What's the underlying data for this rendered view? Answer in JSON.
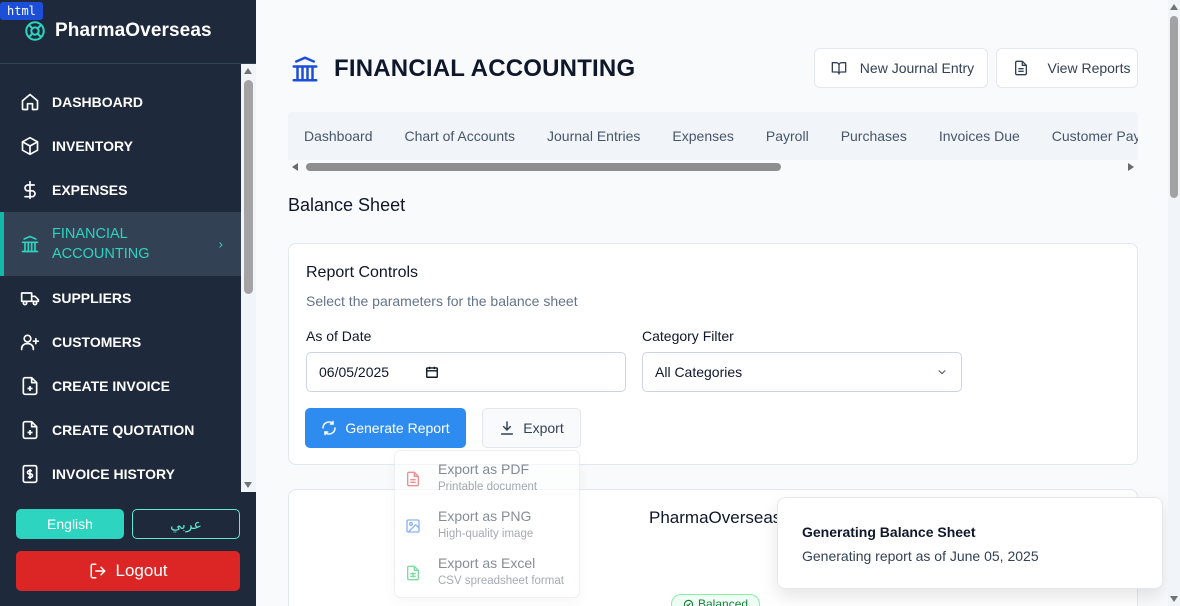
{
  "debug_tag": "html",
  "brand": {
    "name": "PharmaOverseas",
    "icon": "lifebuoy-icon"
  },
  "sidebar": {
    "items": [
      {
        "label": "DASHBOARD",
        "icon": "home-icon"
      },
      {
        "label": "INVENTORY",
        "icon": "box-icon"
      },
      {
        "label": "EXPENSES",
        "icon": "dollar-icon"
      },
      {
        "label": "FINANCIAL ACCOUNTING",
        "icon": "bank-icon",
        "active": true
      },
      {
        "label": "SUPPLIERS",
        "icon": "truck-icon"
      },
      {
        "label": "CUSTOMERS",
        "icon": "user-plus-icon"
      },
      {
        "label": "CREATE INVOICE",
        "icon": "file-plus-icon"
      },
      {
        "label": "CREATE QUOTATION",
        "icon": "file-plus-icon"
      },
      {
        "label": "INVOICE HISTORY",
        "icon": "receipt-icon"
      }
    ],
    "lang_en": "English",
    "lang_ar": "عربي",
    "logout": "Logout"
  },
  "header": {
    "title": "FINANCIAL ACCOUNTING",
    "new_journal_entry": "New Journal Entry",
    "view_reports": "View Reports"
  },
  "tabs": [
    "Dashboard",
    "Chart of Accounts",
    "Journal Entries",
    "Expenses",
    "Payroll",
    "Purchases",
    "Invoices Due",
    "Customer Payments"
  ],
  "section_title": "Balance Sheet",
  "report_controls": {
    "title": "Report Controls",
    "subtitle": "Select the parameters for the balance sheet",
    "as_of_date_label": "As of Date",
    "as_of_date_value": "06/05/2025",
    "category_label": "Category Filter",
    "category_value": "All Categories",
    "generate_button": "Generate Report",
    "export_button": "Export"
  },
  "export_menu": [
    {
      "title": "Export as PDF",
      "desc": "Printable document",
      "color": "#ef4444"
    },
    {
      "title": "Export as PNG",
      "desc": "High-quality image",
      "color": "#3b82f6"
    },
    {
      "title": "Export as Excel",
      "desc": "CSV spreadsheet format",
      "color": "#22c55e"
    }
  ],
  "report_preview": {
    "company": "PharmaOverseas",
    "status": "Balanced"
  },
  "toast": {
    "title": "Generating Balance Sheet",
    "message": "Generating report as of June 05, 2025"
  },
  "colors": {
    "sidebar_bg": "#1e293b",
    "accent_teal": "#2dd4bf",
    "primary_blue": "#2e8cf0",
    "logout_red": "#dc2626"
  }
}
